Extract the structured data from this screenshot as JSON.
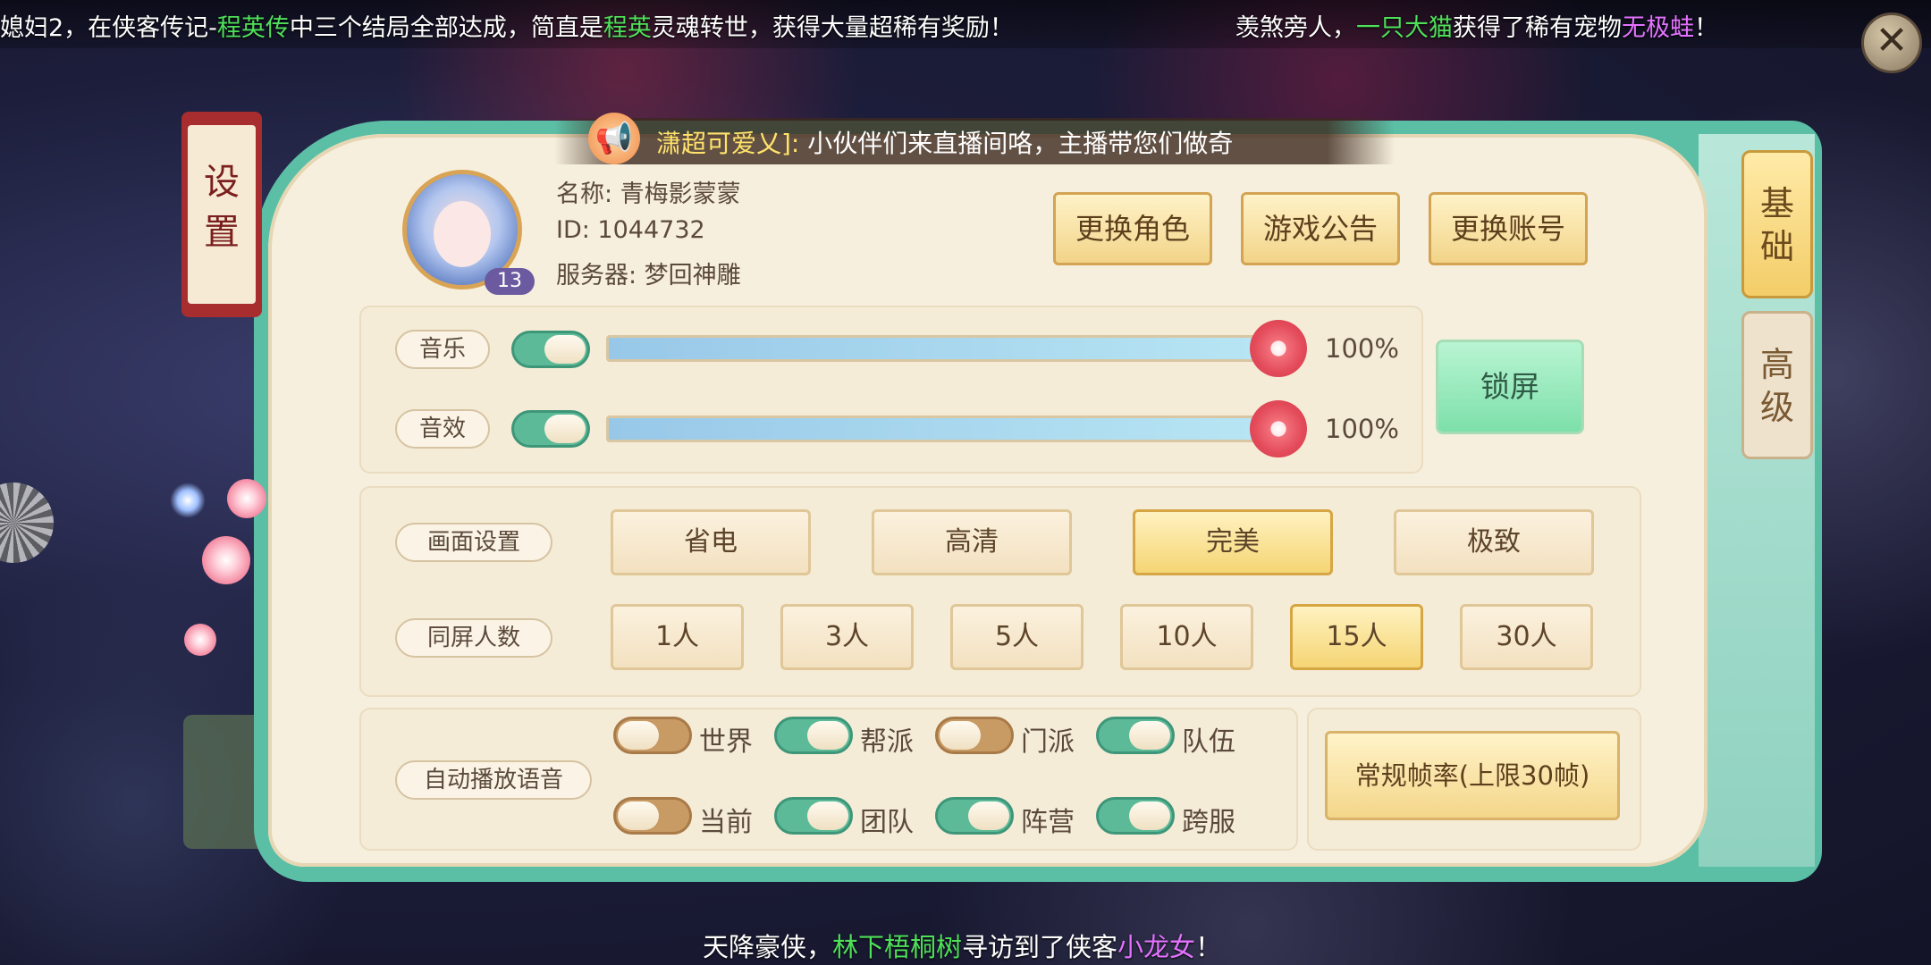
{
  "marquee_top": {
    "left": [
      {
        "text": "媳妇2，在侠客传记-",
        "hl": ""
      },
      {
        "text": "程英传",
        "hl": "green"
      },
      {
        "text": "中三个结局全部达成，简直是",
        "hl": ""
      },
      {
        "text": "程英",
        "hl": "green"
      },
      {
        "text": "灵魂转世，获得大量超稀有奖励！",
        "hl": ""
      }
    ],
    "right": [
      {
        "text": "羡煞旁人，",
        "hl": ""
      },
      {
        "text": "一只大猫",
        "hl": "green"
      },
      {
        "text": "获得了稀有宠物",
        "hl": ""
      },
      {
        "text": "无极蛙",
        "hl": "purple"
      },
      {
        "text": "！",
        "hl": ""
      }
    ]
  },
  "marquee_bottom": [
    {
      "text": "天降豪侠，",
      "hl": ""
    },
    {
      "text": "林下梧桐树",
      "hl": "green"
    },
    {
      "text": "寻访到了侠客",
      "hl": ""
    },
    {
      "text": "小龙女",
      "hl": "purple"
    },
    {
      "text": "！",
      "hl": ""
    }
  ],
  "close_label": "✕",
  "title": {
    "char1": "设",
    "char2": "置"
  },
  "side_tabs": {
    "basic": {
      "c1": "基",
      "c2": "础"
    },
    "advanced": {
      "c1": "高",
      "c2": "级"
    }
  },
  "announcement": {
    "name": "潇超可爱乂]:",
    "message": "小伙伴们来直播间咯，主播带您们做奇"
  },
  "profile": {
    "name_line": "名称: 青梅影蒙蒙",
    "id_line": "ID: 1044732",
    "server_line": "服务器:  梦回神雕",
    "level": "13"
  },
  "account_buttons": {
    "change_role": "更换角色",
    "announcement": "游戏公告",
    "change_account": "更换账号"
  },
  "audio": {
    "music": {
      "label": "音乐",
      "enabled": true,
      "value": 100,
      "value_text": "100%"
    },
    "sfx": {
      "label": "音效",
      "enabled": true,
      "value": 100,
      "value_text": "100%"
    },
    "lock_screen": "锁屏"
  },
  "graphics": {
    "label": "画面设置",
    "options": [
      "省电",
      "高清",
      "完美",
      "极致"
    ],
    "selected": "完美"
  },
  "players": {
    "label": "同屏人数",
    "options": [
      "1人",
      "3人",
      "5人",
      "10人",
      "15人",
      "30人"
    ],
    "selected": "15人"
  },
  "voice": {
    "label": "自动播放语音",
    "items": [
      {
        "label": "世界",
        "on": false
      },
      {
        "label": "帮派",
        "on": true
      },
      {
        "label": "门派",
        "on": false
      },
      {
        "label": "队伍",
        "on": true
      },
      {
        "label": "当前",
        "on": false
      },
      {
        "label": "团队",
        "on": true
      },
      {
        "label": "阵营",
        "on": true
      },
      {
        "label": "跨服",
        "on": true
      }
    ]
  },
  "frame_rate": "常规帧率(上限30帧)"
}
